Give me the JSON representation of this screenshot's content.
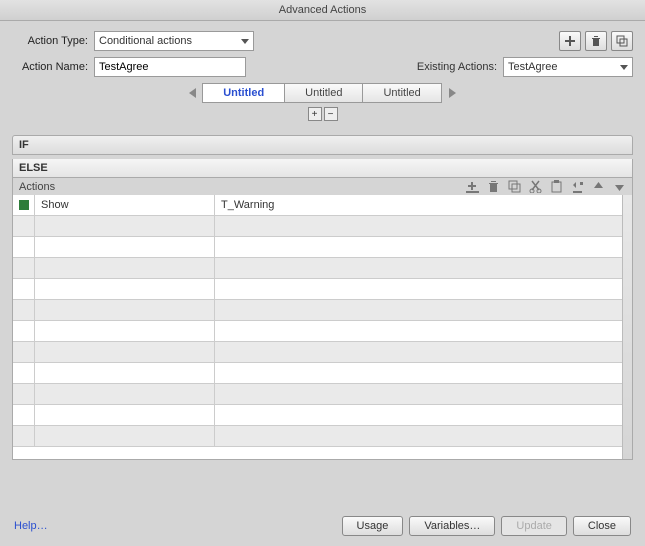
{
  "title": "Advanced Actions",
  "labels": {
    "action_type": "Action Type:",
    "action_name": "Action Name:",
    "existing_actions": "Existing Actions:"
  },
  "action_type_value": "Conditional actions",
  "action_name_value": "TestAgree",
  "existing_actions_value": "TestAgree",
  "tabs": [
    {
      "label": "Untitled",
      "active": true
    },
    {
      "label": "Untitled",
      "active": false
    },
    {
      "label": "Untitled",
      "active": false
    }
  ],
  "small_buttons": {
    "plus": "+",
    "minus": "−"
  },
  "sections": {
    "if": "IF",
    "else": "ELSE"
  },
  "actions_label": "Actions",
  "grid_rows": [
    {
      "marker": true,
      "action": "Show",
      "target": "T_Warning",
      "alt": false
    },
    {
      "marker": false,
      "action": "",
      "target": "",
      "alt": true
    },
    {
      "marker": false,
      "action": "",
      "target": "",
      "alt": false
    },
    {
      "marker": false,
      "action": "",
      "target": "",
      "alt": true
    },
    {
      "marker": false,
      "action": "",
      "target": "",
      "alt": false
    },
    {
      "marker": false,
      "action": "",
      "target": "",
      "alt": true
    },
    {
      "marker": false,
      "action": "",
      "target": "",
      "alt": false
    },
    {
      "marker": false,
      "action": "",
      "target": "",
      "alt": true
    },
    {
      "marker": false,
      "action": "",
      "target": "",
      "alt": false
    },
    {
      "marker": false,
      "action": "",
      "target": "",
      "alt": true
    },
    {
      "marker": false,
      "action": "",
      "target": "",
      "alt": false
    },
    {
      "marker": false,
      "action": "",
      "target": "",
      "alt": true
    }
  ],
  "footer": {
    "help": "Help…",
    "usage": "Usage",
    "variables": "Variables…",
    "update": "Update",
    "close": "Close"
  }
}
